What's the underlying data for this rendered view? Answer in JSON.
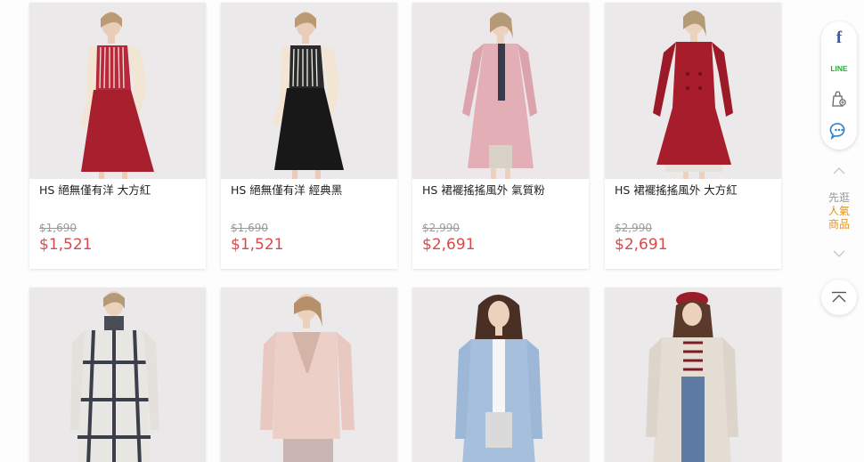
{
  "products": [
    {
      "name": "HS 絕無僅有洋 大方紅",
      "original_price": "$1,690",
      "sale_price": "$1,521"
    },
    {
      "name": "HS 絕無僅有洋 經典黑",
      "original_price": "$1,690",
      "sale_price": "$1,521"
    },
    {
      "name": "HS 裙襬搖搖風外 氣質粉",
      "original_price": "$2,990",
      "sale_price": "$2,691"
    },
    {
      "name": "HS 裙襬搖搖風外 大方紅",
      "original_price": "$2,990",
      "sale_price": "$2,691"
    }
  ],
  "sidebar": {
    "facebook_label": "f",
    "line_label": "LINE",
    "popular": [
      "先逛",
      "人氣",
      "商品"
    ]
  },
  "colors": {
    "sale_price": "#d94a4a",
    "popular_accent": "#e8921c",
    "facebook": "#3b5998",
    "line": "#22b033"
  }
}
